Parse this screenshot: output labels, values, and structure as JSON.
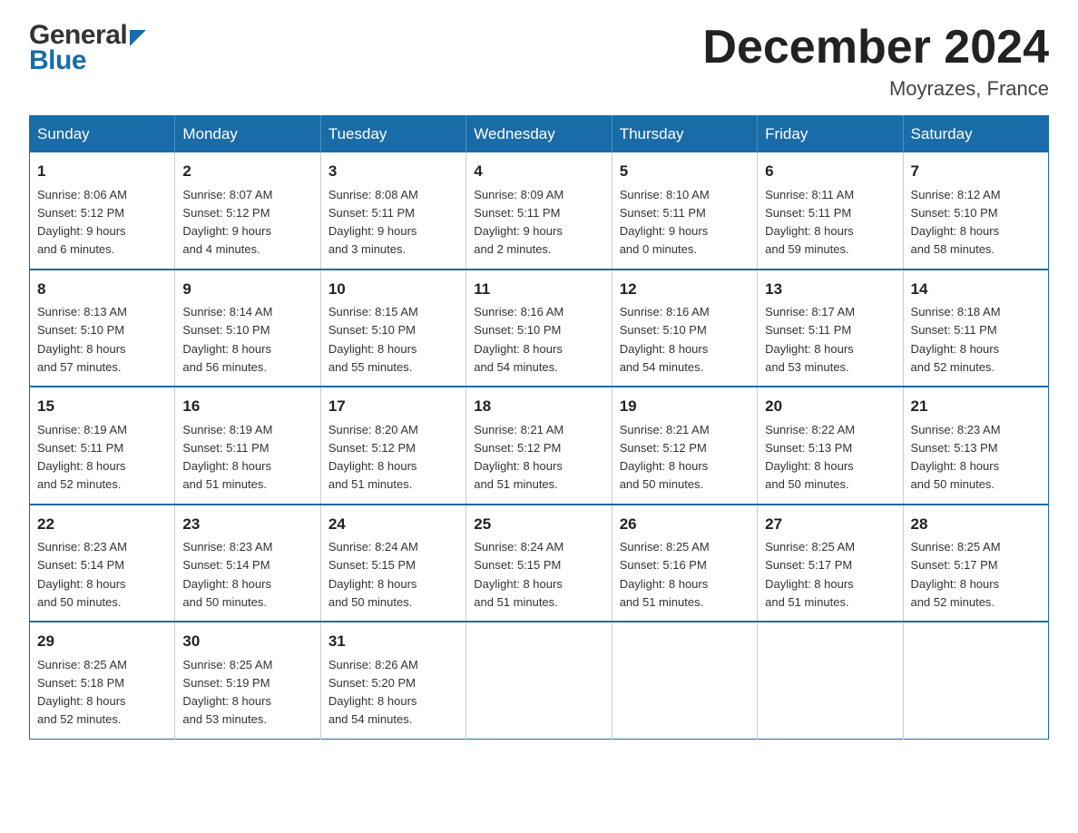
{
  "header": {
    "logo_general": "General",
    "logo_blue": "Blue",
    "month_title": "December 2024",
    "location": "Moyrazes, France"
  },
  "weekdays": [
    "Sunday",
    "Monday",
    "Tuesday",
    "Wednesday",
    "Thursday",
    "Friday",
    "Saturday"
  ],
  "weeks": [
    [
      {
        "day": "1",
        "sunrise": "8:06 AM",
        "sunset": "5:12 PM",
        "daylight": "9 hours and 6 minutes."
      },
      {
        "day": "2",
        "sunrise": "8:07 AM",
        "sunset": "5:12 PM",
        "daylight": "9 hours and 4 minutes."
      },
      {
        "day": "3",
        "sunrise": "8:08 AM",
        "sunset": "5:11 PM",
        "daylight": "9 hours and 3 minutes."
      },
      {
        "day": "4",
        "sunrise": "8:09 AM",
        "sunset": "5:11 PM",
        "daylight": "9 hours and 2 minutes."
      },
      {
        "day": "5",
        "sunrise": "8:10 AM",
        "sunset": "5:11 PM",
        "daylight": "9 hours and 0 minutes."
      },
      {
        "day": "6",
        "sunrise": "8:11 AM",
        "sunset": "5:11 PM",
        "daylight": "8 hours and 59 minutes."
      },
      {
        "day": "7",
        "sunrise": "8:12 AM",
        "sunset": "5:10 PM",
        "daylight": "8 hours and 58 minutes."
      }
    ],
    [
      {
        "day": "8",
        "sunrise": "8:13 AM",
        "sunset": "5:10 PM",
        "daylight": "8 hours and 57 minutes."
      },
      {
        "day": "9",
        "sunrise": "8:14 AM",
        "sunset": "5:10 PM",
        "daylight": "8 hours and 56 minutes."
      },
      {
        "day": "10",
        "sunrise": "8:15 AM",
        "sunset": "5:10 PM",
        "daylight": "8 hours and 55 minutes."
      },
      {
        "day": "11",
        "sunrise": "8:16 AM",
        "sunset": "5:10 PM",
        "daylight": "8 hours and 54 minutes."
      },
      {
        "day": "12",
        "sunrise": "8:16 AM",
        "sunset": "5:10 PM",
        "daylight": "8 hours and 54 minutes."
      },
      {
        "day": "13",
        "sunrise": "8:17 AM",
        "sunset": "5:11 PM",
        "daylight": "8 hours and 53 minutes."
      },
      {
        "day": "14",
        "sunrise": "8:18 AM",
        "sunset": "5:11 PM",
        "daylight": "8 hours and 52 minutes."
      }
    ],
    [
      {
        "day": "15",
        "sunrise": "8:19 AM",
        "sunset": "5:11 PM",
        "daylight": "8 hours and 52 minutes."
      },
      {
        "day": "16",
        "sunrise": "8:19 AM",
        "sunset": "5:11 PM",
        "daylight": "8 hours and 51 minutes."
      },
      {
        "day": "17",
        "sunrise": "8:20 AM",
        "sunset": "5:12 PM",
        "daylight": "8 hours and 51 minutes."
      },
      {
        "day": "18",
        "sunrise": "8:21 AM",
        "sunset": "5:12 PM",
        "daylight": "8 hours and 51 minutes."
      },
      {
        "day": "19",
        "sunrise": "8:21 AM",
        "sunset": "5:12 PM",
        "daylight": "8 hours and 50 minutes."
      },
      {
        "day": "20",
        "sunrise": "8:22 AM",
        "sunset": "5:13 PM",
        "daylight": "8 hours and 50 minutes."
      },
      {
        "day": "21",
        "sunrise": "8:23 AM",
        "sunset": "5:13 PM",
        "daylight": "8 hours and 50 minutes."
      }
    ],
    [
      {
        "day": "22",
        "sunrise": "8:23 AM",
        "sunset": "5:14 PM",
        "daylight": "8 hours and 50 minutes."
      },
      {
        "day": "23",
        "sunrise": "8:23 AM",
        "sunset": "5:14 PM",
        "daylight": "8 hours and 50 minutes."
      },
      {
        "day": "24",
        "sunrise": "8:24 AM",
        "sunset": "5:15 PM",
        "daylight": "8 hours and 50 minutes."
      },
      {
        "day": "25",
        "sunrise": "8:24 AM",
        "sunset": "5:15 PM",
        "daylight": "8 hours and 51 minutes."
      },
      {
        "day": "26",
        "sunrise": "8:25 AM",
        "sunset": "5:16 PM",
        "daylight": "8 hours and 51 minutes."
      },
      {
        "day": "27",
        "sunrise": "8:25 AM",
        "sunset": "5:17 PM",
        "daylight": "8 hours and 51 minutes."
      },
      {
        "day": "28",
        "sunrise": "8:25 AM",
        "sunset": "5:17 PM",
        "daylight": "8 hours and 52 minutes."
      }
    ],
    [
      {
        "day": "29",
        "sunrise": "8:25 AM",
        "sunset": "5:18 PM",
        "daylight": "8 hours and 52 minutes."
      },
      {
        "day": "30",
        "sunrise": "8:25 AM",
        "sunset": "5:19 PM",
        "daylight": "8 hours and 53 minutes."
      },
      {
        "day": "31",
        "sunrise": "8:26 AM",
        "sunset": "5:20 PM",
        "daylight": "8 hours and 54 minutes."
      },
      null,
      null,
      null,
      null
    ]
  ],
  "labels": {
    "sunrise": "Sunrise:",
    "sunset": "Sunset:",
    "daylight": "Daylight:"
  }
}
